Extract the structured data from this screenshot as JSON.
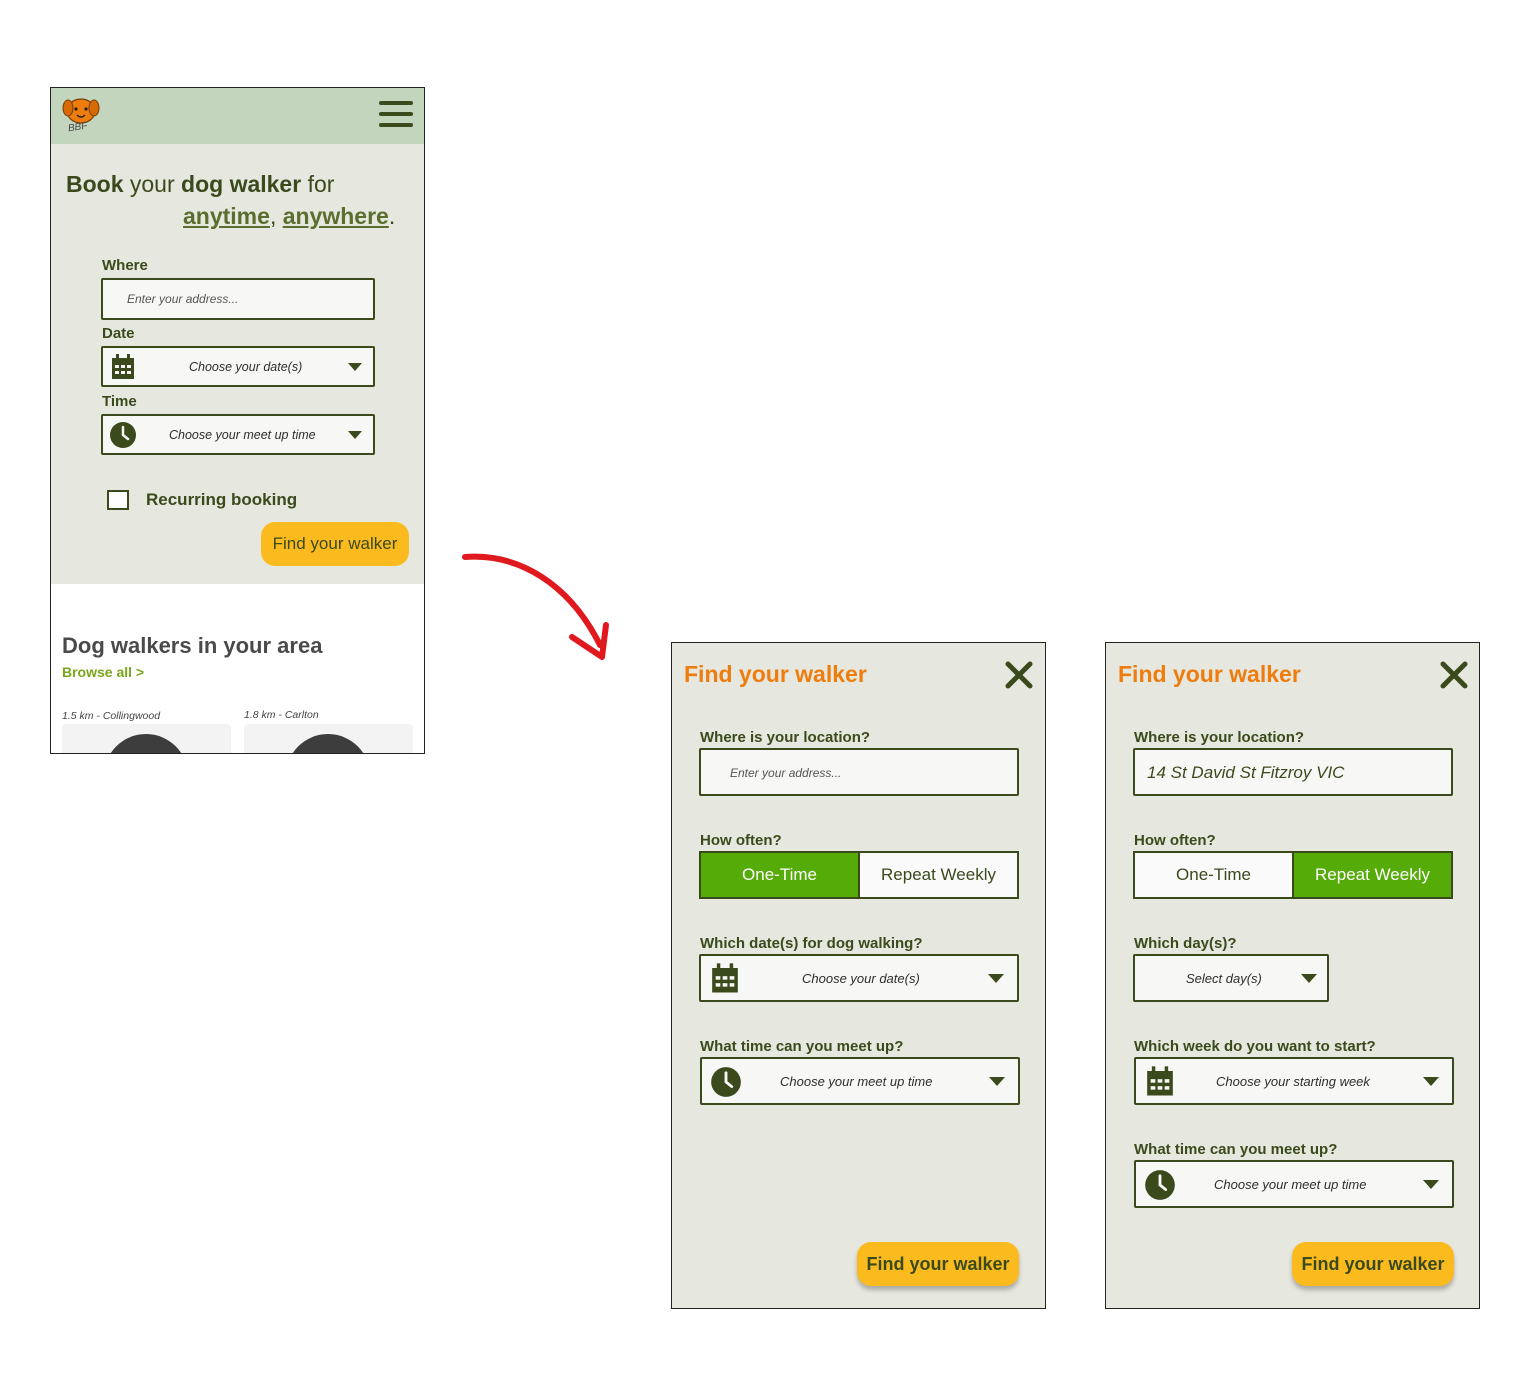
{
  "colors": {
    "topbar": "#c3d5bc",
    "background": "#e6e7de",
    "text_dark": "#3a4a1c",
    "accent_orange": "#ee7d0e",
    "button_yellow": "#fbbb1f",
    "selected_green": "#55ab08",
    "link_green": "#7aa51b",
    "arrow_red": "#e0191f"
  },
  "home": {
    "logo_text": "BBF",
    "menu_icon": "hamburger-menu-icon",
    "headline": {
      "w1": "Book",
      "w2": " your ",
      "w3": "dog walker",
      "w4": " for",
      "w5": "anytime",
      "w6": ", ",
      "w7": "anywhere",
      "w8": "."
    },
    "where_label": "Where",
    "where_placeholder": "Enter your address...",
    "date_label": "Date",
    "date_value": "Choose your date(s)",
    "time_label": "Time",
    "time_value": "Choose your meet up time",
    "recurring_label": "Recurring booking",
    "recurring_checked": false,
    "cta": "Find your walker",
    "section_title": "Dog walkers in your area",
    "browse_all": "Browse all >",
    "walkers": [
      {
        "meta": "1.5 km - Collingwood"
      },
      {
        "meta": "1.8 km - Carlton"
      }
    ]
  },
  "modal_one_time": {
    "title": "Find your walker",
    "location_label": "Where is your location?",
    "location_placeholder": "Enter your address...",
    "often_label": "How often?",
    "opt_one_time": "One-Time",
    "opt_repeat": "Repeat Weekly",
    "selected": "One-Time",
    "dates_label": "Which date(s) for dog walking?",
    "dates_value": "Choose your date(s)",
    "time_label": "What time can you meet up?",
    "time_value": "Choose your meet up time",
    "cta": "Find your walker"
  },
  "modal_weekly": {
    "title": "Find your walker",
    "location_label": "Where is your location?",
    "location_value": "14 St David St Fitzroy VIC",
    "often_label": "How often?",
    "opt_one_time": "One-Time",
    "opt_repeat": "Repeat Weekly",
    "selected": "Repeat Weekly",
    "days_label": "Which day(s)?",
    "days_value": "Select day(s)",
    "week_label": "Which week do you want to start?",
    "week_value": "Choose your starting week",
    "time_label": "What time can you meet up?",
    "time_value": "Choose your meet up time",
    "cta": "Find your walker"
  }
}
